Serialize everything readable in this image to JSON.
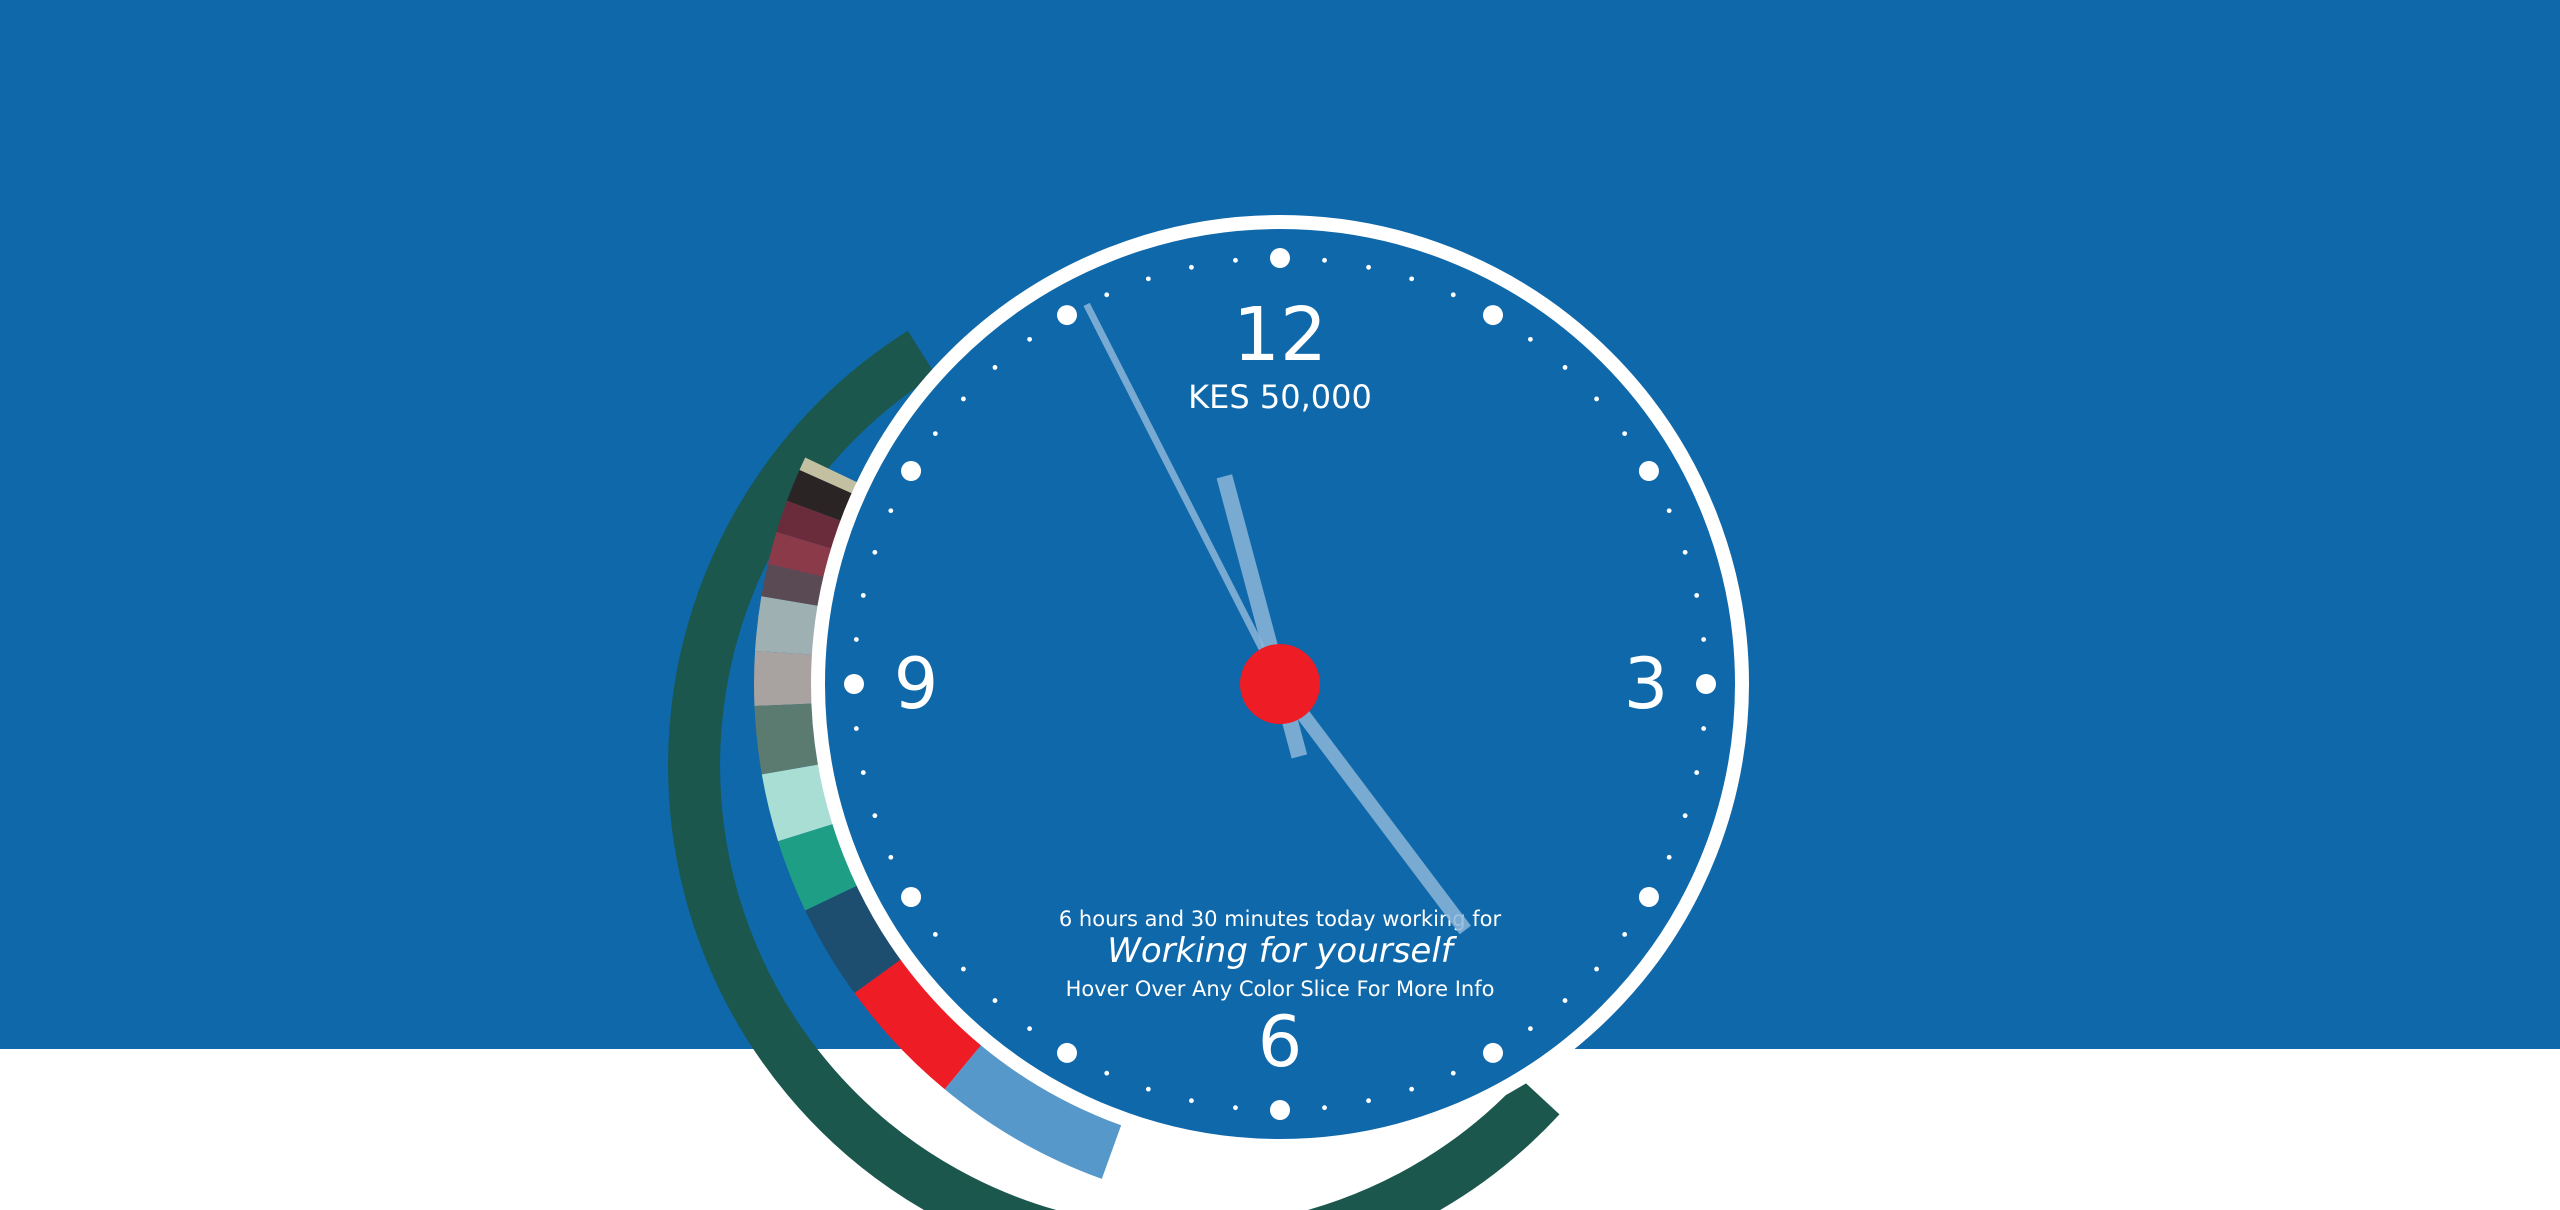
{
  "colors": {
    "background": "#0e68aa",
    "page_bottom": "#ffffff",
    "outer_ring": "#1b574d",
    "inner_ring": "#ffffff",
    "center_dot": "#ee1c25",
    "hands": "#8cb6da",
    "ticks": "#ffffff"
  },
  "clock": {
    "numerals": {
      "twelve": "12",
      "three": "3",
      "six": "6",
      "nine": "9"
    },
    "amount": "KES 50,000",
    "info": {
      "duration": "6 hours and 30 minutes today working for",
      "category": "Working for yourself",
      "hint": "Hover Over Any Color Slice For More Info"
    },
    "time_shown": {
      "hours": 4,
      "minutes": 55.5,
      "seconds": 27
    },
    "working_arc_hours": 6.5
  },
  "color_slices": [
    {
      "color": "#c2c0a0",
      "extent": 0.25
    },
    {
      "color": "#2a2424",
      "extent": 0.6
    },
    {
      "color": "#6a2c3a",
      "extent": 0.6
    },
    {
      "color": "#8b3a4a",
      "extent": 0.6
    },
    {
      "color": "#5a4a54",
      "extent": 0.6
    },
    {
      "color": "#9fb0b3",
      "extent": 1.0
    },
    {
      "color": "#a8a2a0",
      "extent": 1.0
    },
    {
      "color": "#5b7a70",
      "extent": 1.25
    },
    {
      "color": "#a9ded5",
      "extent": 1.25
    },
    {
      "color": "#1f9e86",
      "extent": 1.35
    },
    {
      "color": "#1d4e70",
      "extent": 1.75
    },
    {
      "color": "#ee1c25",
      "extent": 2.4
    },
    {
      "color": "#5798cb",
      "extent": 3.3
    }
  ]
}
